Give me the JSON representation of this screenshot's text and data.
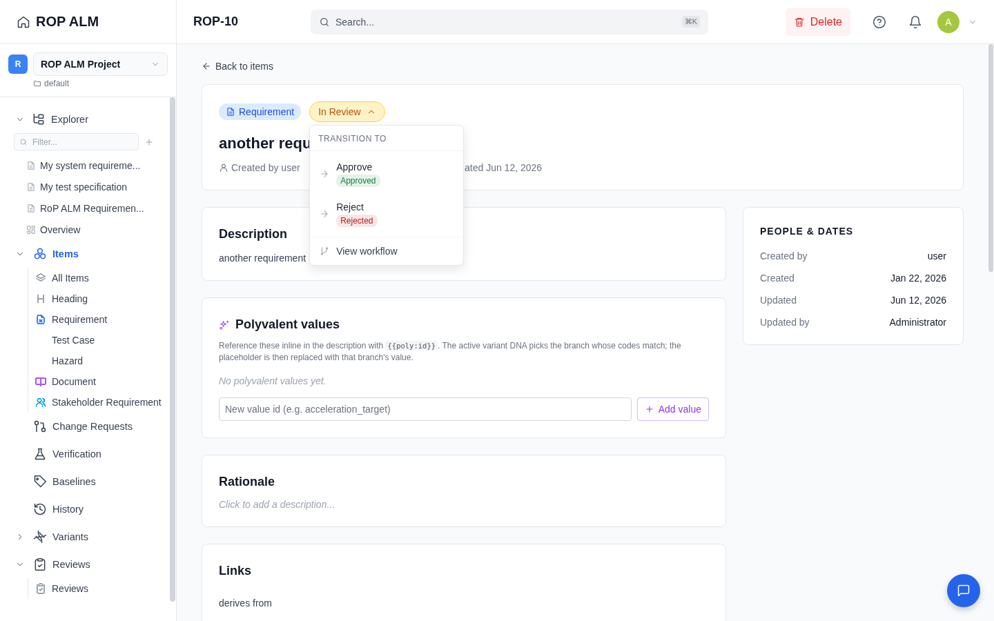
{
  "app": {
    "name": "ROP ALM"
  },
  "project": {
    "initial": "R",
    "name": "ROP ALM Project",
    "folder": "default"
  },
  "explorer": {
    "label": "Explorer",
    "expanded": true,
    "filter_placeholder": "Filter...",
    "documents": [
      {
        "label": "My system requireme..."
      },
      {
        "label": "My test specification"
      },
      {
        "label": "RoP ALM Requiremen..."
      }
    ],
    "overview": "Overview"
  },
  "nav": [
    {
      "label": "Items",
      "expanded": true,
      "selected": true,
      "children": [
        {
          "label": "All Items",
          "color": "#9ca3af"
        },
        {
          "label": "Heading",
          "color": "#9ca3af"
        },
        {
          "label": "Requirement",
          "color": "#3b82f6"
        },
        {
          "label": "Test Case"
        },
        {
          "label": "Hazard"
        },
        {
          "label": "Document",
          "color": "#a855f7"
        },
        {
          "label": "Stakeholder Requirement",
          "color": "#0ea5e9"
        }
      ]
    },
    {
      "label": "Change Requests",
      "selected": false
    },
    {
      "label": "Verification",
      "selected": false
    },
    {
      "label": "Baselines",
      "selected": false
    },
    {
      "label": "History",
      "selected": false
    },
    {
      "label": "Variants",
      "expanded": false,
      "selected": false
    },
    {
      "label": "Reviews",
      "expanded": true,
      "selected": false,
      "children": [
        {
          "label": "Reviews",
          "color": "#9ca3af"
        }
      ]
    }
  ],
  "header": {
    "title": "ROP-10",
    "search": {
      "placeholder": "Search...",
      "shortcut": "⌘K"
    },
    "delete": "Delete",
    "user_initial": "A"
  },
  "item": {
    "back": "Back to items",
    "type": "Requirement",
    "status": {
      "label": "In Review",
      "expanded": true
    },
    "title": "another requ",
    "created_by": "Created by user",
    "updated": "ated Jun 12, 2026"
  },
  "transition_menu": {
    "heading": "TRANSITION TO",
    "options": [
      {
        "action": "Approve",
        "result": "Approved",
        "color": "#15803d"
      },
      {
        "action": "Reject",
        "result": "Rejected",
        "color": "#b91c1c"
      }
    ],
    "view_workflow": "View workflow"
  },
  "description": {
    "title": "Description",
    "text": "another requirement"
  },
  "polyvalent": {
    "title": "Polyvalent values",
    "text_before": "Reference these inline in the description with",
    "code": "{{poly:id}}",
    "text_after": ". The active variant DNA picks the branch whose codes match; the placeholder is then replaced with that branch's value.",
    "empty": "No polyvalent values yet.",
    "input_placeholder": "New value id (e.g. acceleration_target)",
    "add_button": "Add value"
  },
  "rationale": {
    "title": "Rationale",
    "placeholder": "Click to add a description..."
  },
  "links": {
    "title": "Links",
    "subheading": "derives from"
  },
  "people": {
    "title": "PEOPLE & DATES",
    "rows": [
      {
        "label": "Created by",
        "value": "user"
      },
      {
        "label": "Created",
        "value": "Jan 22, 2026"
      },
      {
        "label": "Updated",
        "value": "Jun 12, 2026"
      },
      {
        "label": "Updated by",
        "value": "Administrator"
      }
    ]
  }
}
